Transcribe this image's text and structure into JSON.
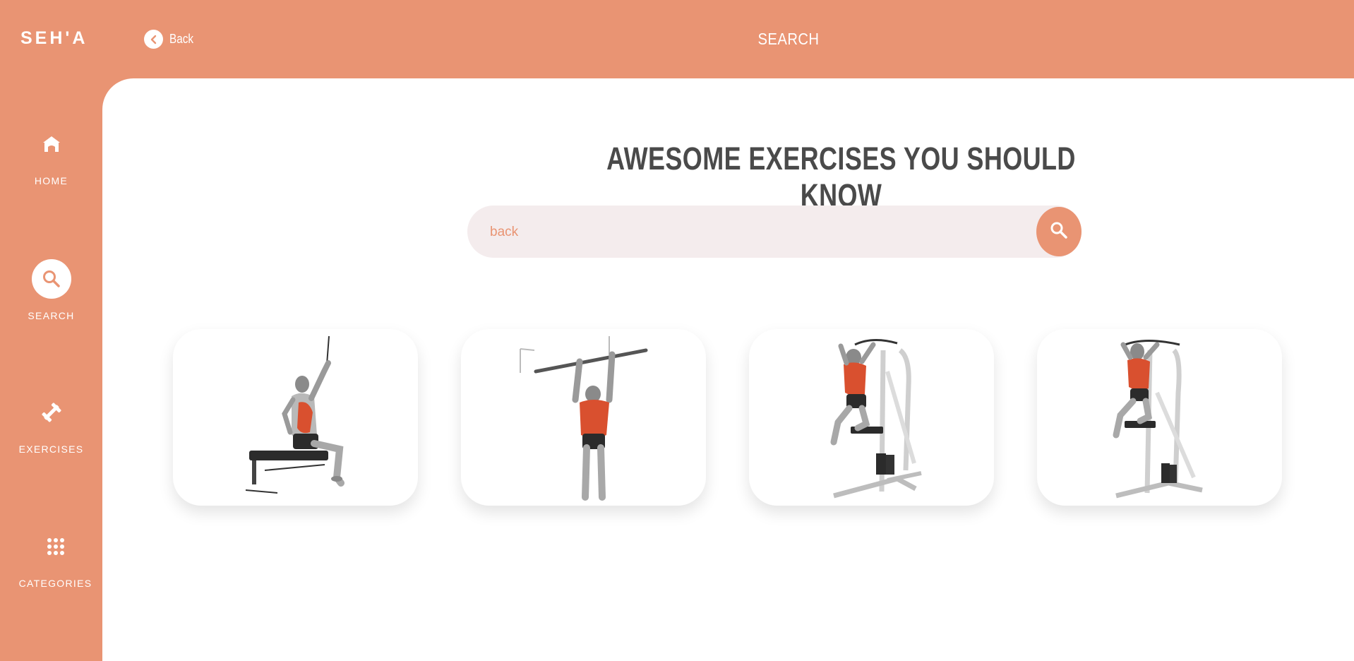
{
  "app": {
    "brand": "SEH'A"
  },
  "header": {
    "back_label": "Back",
    "title": "SEARCH"
  },
  "sidebar": {
    "items": [
      {
        "label": "HOME",
        "icon": "home-icon"
      },
      {
        "label": "SEARCH",
        "icon": "search-icon",
        "active": true
      },
      {
        "label": "EXERCISES",
        "icon": "dumbbell-icon"
      },
      {
        "label": "CATEGORIES",
        "icon": "grid-icon"
      }
    ]
  },
  "main": {
    "title": "AWESOME EXERCISES YOU SHOULD KNOW",
    "search": {
      "value": "back"
    },
    "results": [
      {
        "icon": "seated-cable-pulldown-illustration"
      },
      {
        "icon": "pull-up-bar-illustration"
      },
      {
        "icon": "assisted-pull-up-machine-illustration"
      },
      {
        "icon": "assisted-dip-pull-station-illustration"
      }
    ]
  },
  "colors": {
    "accent": "#e99473",
    "background": "#ffffff",
    "title_text": "#4a4a4a",
    "search_bg": "#f4eced",
    "muscle": "#d9502f"
  }
}
